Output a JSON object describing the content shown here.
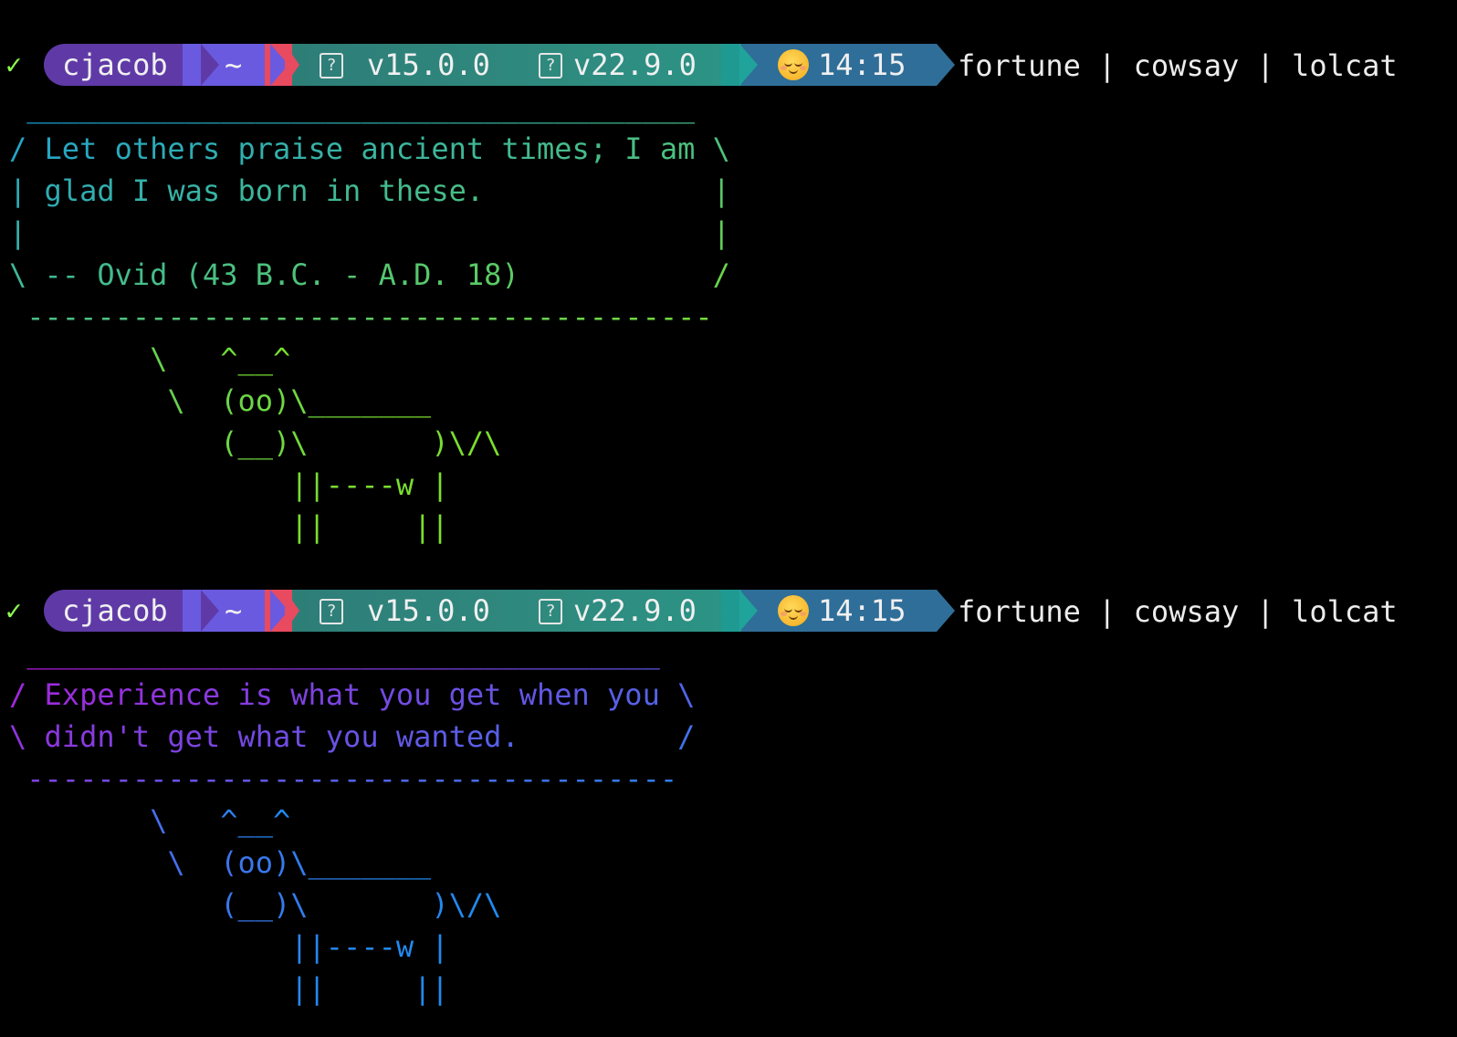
{
  "terminal": {
    "sessions": [
      {
        "prompt": {
          "status_icon": "✓",
          "user": "cjacob",
          "dir": "~",
          "node_icon": "?",
          "node_version": "v15.0.0",
          "npm_icon": "?",
          "npm_version": "v22.9.0",
          "mood_icon": "relieved-face-emoji",
          "time": "14:15",
          "command": "fortune | cowsay | lolcat"
        },
        "output_lines": [
          " ______________________________________",
          "/ Let others praise ancient times; I am \\",
          "| glad I was born in these.             |",
          "|                                       |",
          "\\ -- Ovid (43 B.C. - A.D. 18)           /",
          " ---------------------------------------",
          "        \\   ^__^",
          "         \\  (oo)\\_______",
          "            (__)\\       )\\/\\",
          "                ||----w |",
          "                ||     ||"
        ],
        "palette": {
          "start": "#1a9fd8",
          "end": "#7be02a"
        }
      },
      {
        "prompt": {
          "status_icon": "✓",
          "user": "cjacob",
          "dir": "~",
          "node_icon": "?",
          "node_version": "v15.0.0",
          "npm_icon": "?",
          "npm_version": "v22.9.0",
          "mood_icon": "relieved-face-emoji",
          "time": "14:15",
          "command": "fortune | cowsay | lolcat"
        },
        "output_lines": [
          " ____________________________________",
          "/ Experience is what you get when you \\",
          "\\ didn't get what you wanted.         /",
          " -------------------------------------",
          "        \\   ^__^",
          "         \\  (oo)\\_______",
          "            (__)\\       )\\/\\",
          "                ||----w |",
          "                ||     ||"
        ],
        "palette": {
          "start": "#b21ad8",
          "end": "#1e8cf0"
        }
      }
    ]
  },
  "colors": {
    "background": "#000000",
    "status_ok": "#8dff4d",
    "user_segment": "#5f3aa6",
    "dir_segment": "#6a5ae0",
    "accent_red": "#e84a5f",
    "version_segment": "#2e7d78",
    "time_segment": "#2f6e98"
  }
}
